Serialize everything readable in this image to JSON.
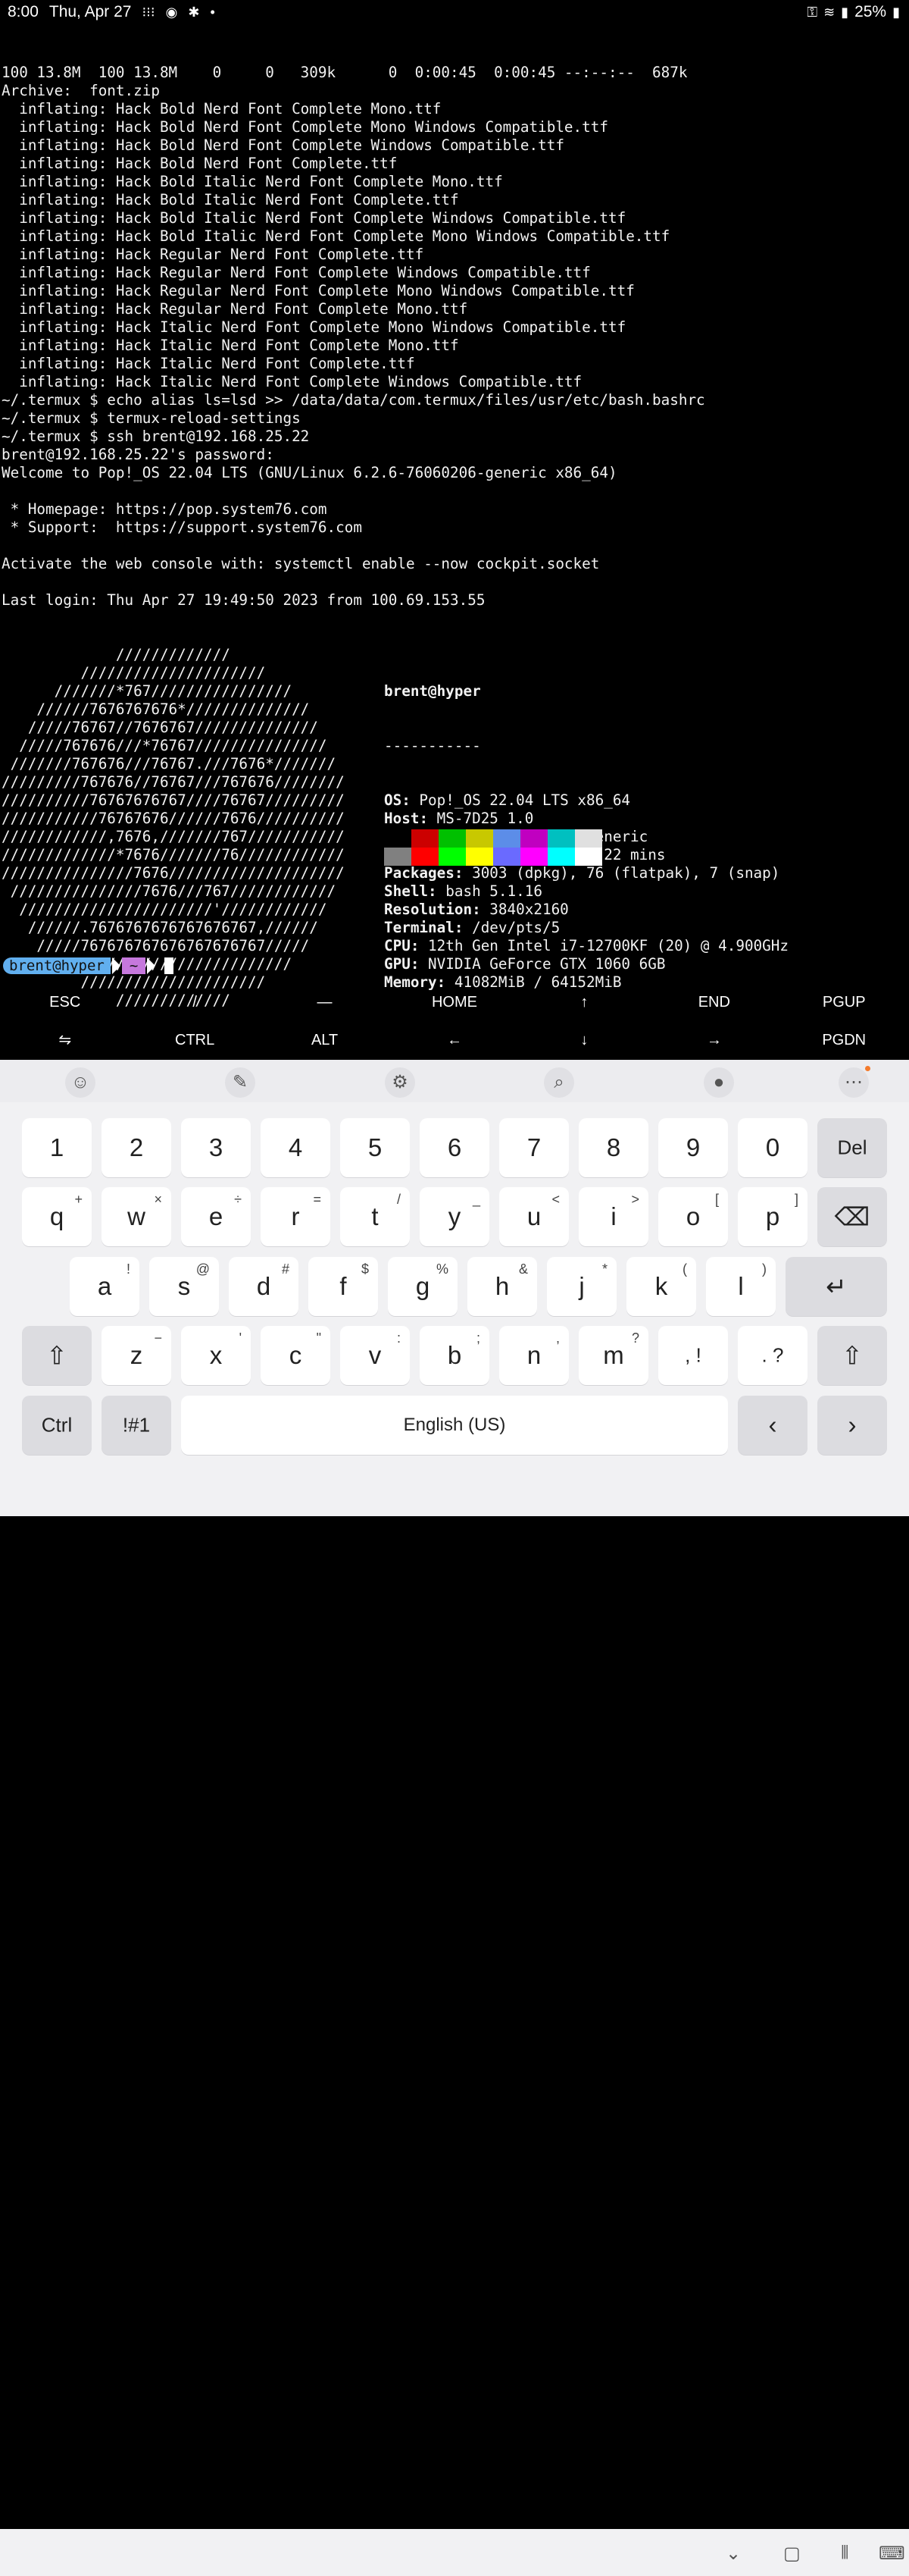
{
  "status": {
    "time": "8:00",
    "date": "Thu, Apr 27",
    "battery": "25%",
    "icons_left": [
      "apps-icon",
      "sync-icon",
      "accessibility-icon",
      "dot-icon"
    ],
    "icons_right": [
      "key-icon",
      "wifi-icon",
      "signal-icon",
      "battery-icon"
    ]
  },
  "terminal_lines": [
    "100 13.8M  100 13.8M    0     0   309k      0  0:00:45  0:00:45 --:--:--  687k",
    "Archive:  font.zip",
    "  inflating: Hack Bold Nerd Font Complete Mono.ttf",
    "  inflating: Hack Bold Nerd Font Complete Mono Windows Compatible.ttf",
    "  inflating: Hack Bold Nerd Font Complete Windows Compatible.ttf",
    "  inflating: Hack Bold Nerd Font Complete.ttf",
    "  inflating: Hack Bold Italic Nerd Font Complete Mono.ttf",
    "  inflating: Hack Bold Italic Nerd Font Complete.ttf",
    "  inflating: Hack Bold Italic Nerd Font Complete Windows Compatible.ttf",
    "  inflating: Hack Bold Italic Nerd Font Complete Mono Windows Compatible.ttf",
    "  inflating: Hack Regular Nerd Font Complete.ttf",
    "  inflating: Hack Regular Nerd Font Complete Windows Compatible.ttf",
    "  inflating: Hack Regular Nerd Font Complete Mono Windows Compatible.ttf",
    "  inflating: Hack Regular Nerd Font Complete Mono.ttf",
    "  inflating: Hack Italic Nerd Font Complete Mono Windows Compatible.ttf",
    "  inflating: Hack Italic Nerd Font Complete Mono.ttf",
    "  inflating: Hack Italic Nerd Font Complete.ttf",
    "  inflating: Hack Italic Nerd Font Complete Windows Compatible.ttf",
    "~/.termux $ echo alias ls=lsd >> /data/data/com.termux/files/usr/etc/bash.bashrc",
    "~/.termux $ termux-reload-settings",
    "~/.termux $ ssh brent@192.168.25.22",
    "brent@192.168.25.22's password:",
    "Welcome to Pop!_OS 22.04 LTS (GNU/Linux 6.2.6-76060206-generic x86_64)",
    "",
    " * Homepage: https://pop.system76.com",
    " * Support:  https://support.system76.com",
    "",
    "Activate the web console with: systemctl enable --now cockpit.socket",
    "",
    "Last login: Thu Apr 27 19:49:50 2023 from 100.69.153.55"
  ],
  "logo_lines": [
    "             /////////////",
    "         /////////////////////",
    "      ///////*767////////////////",
    "    //////7676767676*//////////////",
    "   /////76767//7676767//////////////",
    "  /////767676///*76767///////////////",
    " ///////767676///76767.///7676*///////",
    "/////////767676//76767///767676////////",
    "//////////76767676767////76767/////////",
    "///////////76767676//////7676//////////",
    "////////////,7676,///////767///////////",
    "/////////////*7676///////76////////////",
    "///////////////7676////////////////////",
    " ///////////////7676///767////////////",
    "  //////////////////////'////////////",
    "   //////.7676767676767676767,//////",
    "    /////767676767676767676767/////",
    "      ///////////////////////////",
    "         /////////////////////",
    "             /////////////"
  ],
  "info": {
    "user_host": "brent@hyper",
    "separator": "-----------",
    "rows": [
      {
        "key": "OS",
        "value": " Pop!_OS 22.04 LTS x86_64"
      },
      {
        "key": "Host",
        "value": " MS-7D25 1.0"
      },
      {
        "key": "Kernel",
        "value": " 6.2.6-76060206-generic"
      },
      {
        "key": "Uptime",
        "value": " 22 days, 1 hour, 22 mins"
      },
      {
        "key": "Packages",
        "value": " 3003 (dpkg), 76 (flatpak), 7 (snap)"
      },
      {
        "key": "Shell",
        "value": " bash 5.1.16"
      },
      {
        "key": "Resolution",
        "value": " 3840x2160"
      },
      {
        "key": "Terminal",
        "value": " /dev/pts/5"
      },
      {
        "key": "CPU",
        "value": " 12th Gen Intel i7-12700KF (20) @ 4.900GHz"
      },
      {
        "key": "GPU",
        "value": " NVIDIA GeForce GTX 1060 6GB"
      },
      {
        "key": "Memory",
        "value": " 41082MiB / 64152MiB"
      }
    ],
    "palette_top": [
      "#000000",
      "#cc0000",
      "#00c000",
      "#c8c800",
      "#5c8de8",
      "#c000c0",
      "#00c0c0",
      "#e0e0e0"
    ],
    "palette_bottom": [
      "#808080",
      "#ff0000",
      "#00ff00",
      "#ffff00",
      "#6a6aff",
      "#ff00ff",
      "#00ffff",
      "#ffffff"
    ]
  },
  "prompt": {
    "user": "brent@hyper",
    "dir": "~"
  },
  "extra_keys": {
    "row1": [
      "ESC",
      "/",
      "—",
      "HOME",
      "↑",
      "END",
      "PGUP"
    ],
    "row2": [
      "⇋",
      "CTRL",
      "ALT",
      "←",
      "↓",
      "→",
      "PGDN"
    ]
  },
  "keyboard": {
    "toolbar": [
      "emoji-icon",
      "handwriting-icon",
      "settings-icon",
      "search-icon",
      "mic-icon",
      "more-icon"
    ],
    "number_row": [
      "1",
      "2",
      "3",
      "4",
      "5",
      "6",
      "7",
      "8",
      "9",
      "0"
    ],
    "del_label": "Del",
    "row_q": [
      [
        "q",
        "+"
      ],
      [
        "w",
        "×"
      ],
      [
        "e",
        "÷"
      ],
      [
        "r",
        "="
      ],
      [
        "t",
        "/"
      ],
      [
        "y",
        "_"
      ],
      [
        "u",
        "<"
      ],
      [
        "i",
        ">"
      ],
      [
        "o",
        "["
      ],
      [
        "p",
        "]"
      ]
    ],
    "row_a": [
      [
        "a",
        "!"
      ],
      [
        "s",
        "@"
      ],
      [
        "d",
        "#"
      ],
      [
        "f",
        "$"
      ],
      [
        "g",
        "%"
      ],
      [
        "h",
        "&"
      ],
      [
        "j",
        "*"
      ],
      [
        "k",
        "("
      ],
      [
        "l",
        ")"
      ]
    ],
    "row_z": [
      [
        "z",
        "−"
      ],
      [
        "x",
        "'"
      ],
      [
        "c",
        "\""
      ],
      [
        "v",
        ":"
      ],
      [
        "b",
        ";"
      ],
      [
        "n",
        ","
      ],
      [
        "m",
        "?"
      ]
    ],
    "comma_key": ",  !",
    "period_key": ".  ?",
    "ctrl_label": "Ctrl",
    "symbols_label": "!#1",
    "space_label": "English (US)"
  }
}
